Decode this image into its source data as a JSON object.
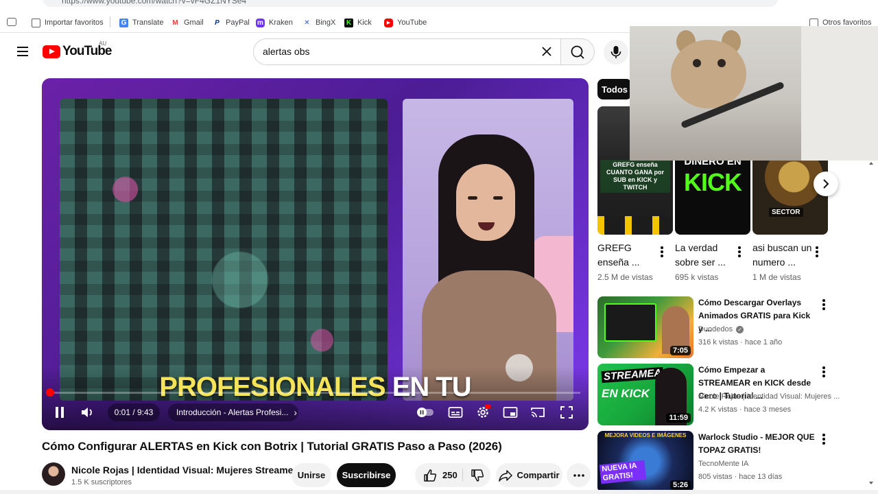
{
  "browser": {
    "url": "https://www.youtube.com/watch?v=vF4GZ1NYSe4",
    "bookmarks": [
      {
        "label": "Importar favoritos",
        "icon": "import-bookmarks-icon"
      },
      {
        "label": "Translate",
        "icon": "translate-icon",
        "color": "#4285f4"
      },
      {
        "label": "Gmail",
        "icon": "gmail-icon",
        "color": "#ea4335"
      },
      {
        "label": "PayPal",
        "icon": "paypal-icon",
        "color": "#003087"
      },
      {
        "label": "Kraken",
        "icon": "kraken-icon",
        "color": "#7132f5"
      },
      {
        "label": "BingX",
        "icon": "bingx-icon",
        "color": "#2a5bd7"
      },
      {
        "label": "Kick",
        "icon": "kick-icon",
        "color": "#53fc18"
      },
      {
        "label": "YouTube",
        "icon": "youtube-icon",
        "color": "#ff0000"
      }
    ],
    "other_bookmarks": "Otros favoritos"
  },
  "header": {
    "logo_text": "YouTube",
    "country_code": "AU",
    "search_value": "alertas obs"
  },
  "player": {
    "caption_yellow": "PROFESIONALES",
    "caption_white": "EN TU",
    "time": "0:01 / 9:43",
    "chapter": "Introducción - Alertas Profesi...",
    "progress": 0.002
  },
  "video": {
    "title": "Cómo Configurar ALERTAS en Kick con Botrix | Tutorial GRATIS Paso a Paso (2026)",
    "channel": "Nicole Rojas | Identidad Visual: Mujeres Streamers",
    "subscribers": "1.5 K suscriptores",
    "join_label": "Unirse",
    "subscribe_label": "Suscribirse",
    "likes": "250",
    "share_label": "Compartir"
  },
  "sidebar": {
    "chip": "Todos",
    "shorts": [
      {
        "title": "GREFG enseña ...",
        "views": "2.5 M de vistas",
        "thumb_text": "GREFG enseña CUANTO GANA por SUB en KICK y TWITCH"
      },
      {
        "title": "La verdad sobre ser ...",
        "views": "695 k vistas",
        "thumb_text_1": "DINERO EN",
        "thumb_text_2": "KICK"
      },
      {
        "title": "asi buscan un numero ...",
        "views": "1 M de vistas",
        "thumb_text": "SECTOR"
      }
    ],
    "recommendations": [
      {
        "title": "Cómo Descargar Overlays Animados GRATIS para Kick y ...",
        "channel": "Duodedos",
        "verified": true,
        "meta": "316 k vistas · hace 1 año",
        "duration": "7:05"
      },
      {
        "title": "Cómo Empezar a STREAMEAR en KICK desde Cero | Tutorial ...",
        "channel": "Nicole Rojas | Identidad Visual: Mujeres ...",
        "verified": false,
        "meta": "4.2 K vistas · hace 3 meses",
        "duration": "11:59",
        "thumb_text_1": "STREAMEA",
        "thumb_text_2": "EN KICK"
      },
      {
        "title": "Warlock Studio - MEJOR QUE TOPAZ GRATIS!",
        "channel": "TecnoMente IA",
        "verified": false,
        "meta": "805 vistas · hace 13 días",
        "duration": "5:26",
        "thumb_text_1": "MEJORA VIDEOS E IMÁGENES",
        "thumb_text_2": "NUEVA IA GRATIS!"
      }
    ]
  },
  "colors": {
    "accent": "#ff0000",
    "kick_green": "#53fc18",
    "player_purple": "#6b21a8"
  }
}
